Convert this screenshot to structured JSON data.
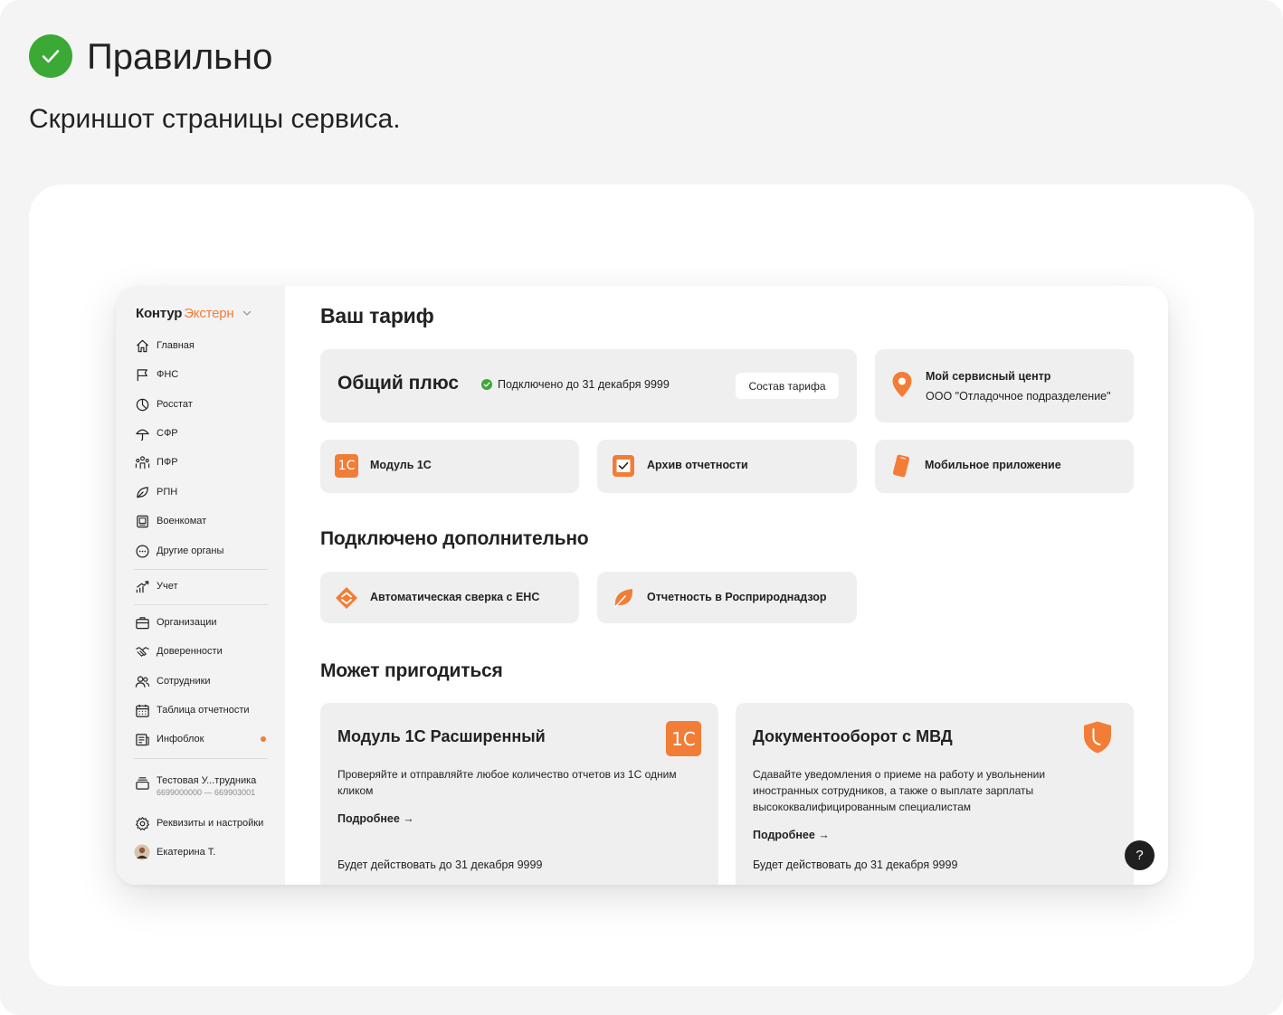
{
  "page": {
    "heading": "Правильно",
    "subheading": "Скриншот страницы сервиса."
  },
  "colors": {
    "accent": "#f27d36",
    "success": "#3aa935",
    "card": "#efefef",
    "sidebar": "#f3f3f3"
  },
  "sidebar": {
    "logo_brand": "Контур",
    "logo_product": "Экстерн",
    "items": [
      {
        "label": "Главная",
        "icon": "home-icon"
      },
      {
        "label": "ФНС",
        "icon": "flag-icon"
      },
      {
        "label": "Росстат",
        "icon": "pie-chart-icon"
      },
      {
        "label": "СФР",
        "icon": "umbrella-icon"
      },
      {
        "label": "ПФР",
        "icon": "people-icon"
      },
      {
        "label": "РПН",
        "icon": "leaf-icon"
      },
      {
        "label": "Военкомат",
        "icon": "id-card-icon"
      },
      {
        "label": "Другие органы",
        "icon": "more-icon"
      }
    ],
    "accounting": {
      "label": "Учет",
      "icon": "chart-up-icon"
    },
    "items2": [
      {
        "label": "Организации",
        "icon": "briefcase-icon"
      },
      {
        "label": "Доверенности",
        "icon": "handshake-icon"
      },
      {
        "label": "Сотрудники",
        "icon": "users-icon"
      },
      {
        "label": "Таблица отчетности",
        "icon": "calendar-icon"
      },
      {
        "label": "Инфоблок",
        "icon": "news-icon"
      }
    ],
    "org_name": "Тестовая У...трудника",
    "org_inn": "6699000000 — 669903001",
    "settings_label": "Реквизиты и настройки",
    "user_name": "Екатерина Т."
  },
  "tariff": {
    "section_title": "Ваш тариф",
    "name": "Общий плюс",
    "status": "Подключено до 31 декабря 9999",
    "composition_button": "Состав тарифа",
    "service_center_title": "Мой сервисный центр",
    "service_center_name": "ООО \"Отладочное подразделение\"",
    "features": [
      {
        "label": "Модуль 1С",
        "icon": "1c-icon",
        "icon_text": "1С"
      },
      {
        "label": "Архив отчетности",
        "icon": "archive-check-icon"
      },
      {
        "label": "Мобильное приложение",
        "icon": "phone-icon"
      }
    ]
  },
  "connected": {
    "section_title": "Подключено дополнительно",
    "items": [
      {
        "label": "Автоматическая сверка с ЕНС",
        "icon": "reconcile-icon"
      },
      {
        "label": "Отчетность в Росприроднадзор",
        "icon": "leaf-icon"
      }
    ]
  },
  "useful": {
    "section_title": "Может пригодиться",
    "cards": [
      {
        "title": "Модуль 1С Расширенный",
        "icon": "1c-icon",
        "icon_text": "1С",
        "desc_line1": "Проверяйте и отправляйте любое количество отчетов из 1С одним",
        "desc_line2": "кликом",
        "desc_line3": "",
        "more": "Подробнее →",
        "footer": "Будет действовать до 31 декабря 9999"
      },
      {
        "title": "Документооборот с МВД",
        "icon": "shield-icon",
        "desc_line1": "Сдавайте уведомления о приеме на работу и увольнении",
        "desc_line2": "иностранных сотрудников, а также о выплате зарплаты",
        "desc_line3": "высококвалифицированным специалистам",
        "more": "Подробнее →",
        "footer": "Будет действовать до 31 декабря 9999"
      }
    ]
  },
  "help_label": "?"
}
